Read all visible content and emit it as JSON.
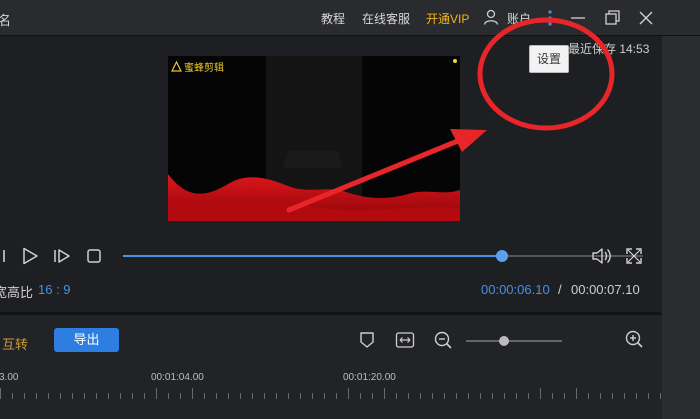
{
  "titlebar": {
    "left_char": "名",
    "menu": [
      {
        "label": "教程"
      },
      {
        "label": "在线客服"
      },
      {
        "label": "开通VIP"
      },
      {
        "label": "账户"
      }
    ]
  },
  "status": {
    "saved_text": "最近保存 14:53"
  },
  "tooltip": {
    "text": "设置"
  },
  "video": {
    "watermark": "蜜蜂剪辑"
  },
  "player": {
    "progress": 0.728,
    "aspect_label": "宽高比",
    "aspect_value": "16 : 9",
    "current_time": "00:00:06.10",
    "separator": "/",
    "total_time": "00:00:07.10"
  },
  "toolbar": {
    "flip_label": "互转",
    "export_label": "导出",
    "zoom_level": 0.4
  },
  "timeline": {
    "labels": [
      "3.00",
      "00:01:04.00",
      "00:01:20.00"
    ]
  },
  "colors": {
    "accent": "#2d7ee0",
    "vip": "#f5b31a",
    "annotation": "#e8262a"
  }
}
